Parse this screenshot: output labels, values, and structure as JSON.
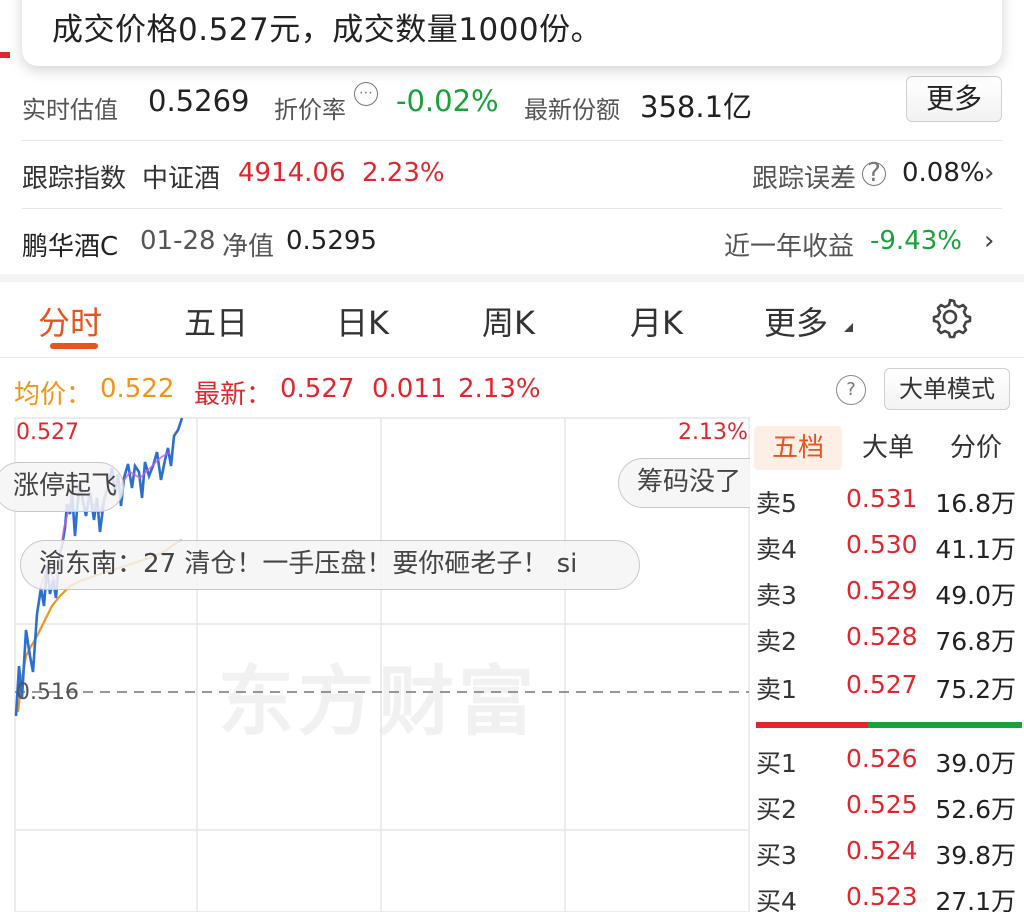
{
  "toast": {
    "text": "成交价格0.527元，成交数量1000份。"
  },
  "summary": {
    "estimate_label": "实时估值",
    "estimate_value": "0.5269",
    "premium_label": "折价率",
    "premium_info_glyph": "⋯",
    "premium_value": "-0.02%",
    "shares_label": "最新份额",
    "shares_value": "358.1亿",
    "more_button": "更多"
  },
  "tracking": {
    "label": "跟踪指数",
    "index_name": "中证酒",
    "index_value": "4914.06",
    "index_change": "2.23%",
    "error_label": "跟踪误差",
    "error_info_glyph": "?",
    "error_value": "0.08%"
  },
  "related_fund": {
    "name": "鹏华酒C",
    "date": "01-28",
    "nav_label": "净值",
    "nav_value": "0.5295",
    "year_label": "近一年收益",
    "year_value": "-9.43%"
  },
  "tabs": [
    {
      "label": "分时",
      "active": true
    },
    {
      "label": "五日"
    },
    {
      "label": "日K"
    },
    {
      "label": "周K"
    },
    {
      "label": "月K"
    },
    {
      "label": "更多"
    }
  ],
  "chart_header": {
    "avg_label": "均价：",
    "avg_value": "0.522",
    "latest_label": "最新：",
    "latest_value": "0.527",
    "change_value": "0.011",
    "change_pct": "2.13%",
    "help_glyph": "?",
    "mode_button": "大单模式"
  },
  "chart_labels": {
    "top_price": "0.527",
    "top_pct": "2.13%",
    "base_price": "0.516",
    "watermark": "东方财富"
  },
  "danmu": [
    "涨停起飞",
    "筹码没了",
    "渝东南：27 清仓！一手压盘！要你砸老子！ si"
  ],
  "order_book": {
    "tabs": [
      "五档",
      "大单",
      "分价"
    ],
    "asks": [
      {
        "name": "卖5",
        "price": "0.531",
        "volume": "16.8万"
      },
      {
        "name": "卖4",
        "price": "0.530",
        "volume": "41.1万"
      },
      {
        "name": "卖3",
        "price": "0.529",
        "volume": "49.0万"
      },
      {
        "name": "卖2",
        "price": "0.528",
        "volume": "76.8万"
      },
      {
        "name": "卖1",
        "price": "0.527",
        "volume": "75.2万"
      }
    ],
    "bids": [
      {
        "name": "买1",
        "price": "0.526",
        "volume": "39.0万"
      },
      {
        "name": "买2",
        "price": "0.525",
        "volume": "52.6万"
      },
      {
        "name": "买3",
        "price": "0.524",
        "volume": "39.8万"
      },
      {
        "name": "买4",
        "price": "0.523",
        "volume": "27.1万"
      }
    ]
  },
  "colors": {
    "up": "#e3262e",
    "down": "#18a33a",
    "accent": "#e8541f",
    "avg": "#f29418",
    "price_line": "#2a6fd1"
  }
}
